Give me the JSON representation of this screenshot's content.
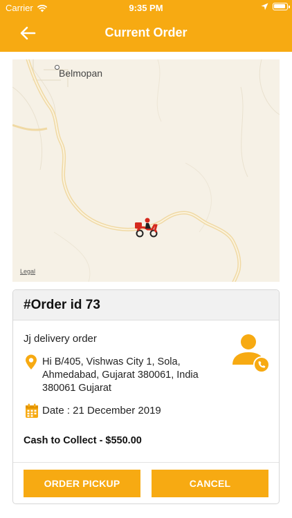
{
  "status_bar": {
    "carrier": "Carrier",
    "time": "9:35 PM",
    "icons": [
      "wifi-icon",
      "location-arrow-icon",
      "battery-icon"
    ]
  },
  "header": {
    "title": "Current Order",
    "back_icon": "arrow-left-icon"
  },
  "map": {
    "city_label": "Belmopan",
    "legal_label": "Legal",
    "marker_icon": "delivery-scooter-icon"
  },
  "order": {
    "heading": "#Order id 73",
    "name": "Jj delivery order",
    "address": "Hi B/405, Vishwas City 1, Sola, Ahmedabad, Gujarat 380061, India 380061 Gujarat",
    "date": "Date : 21 December 2019",
    "cash": "Cash to Collect - $550.00",
    "contact_icon": "contact-call-icon"
  },
  "actions": {
    "pickup_label": "ORDER PICKUP",
    "cancel_label": "CANCEL"
  },
  "colors": {
    "accent": "#F7AA12",
    "card_header": "#F1F1F1",
    "map_background": "#F6F1E6"
  }
}
